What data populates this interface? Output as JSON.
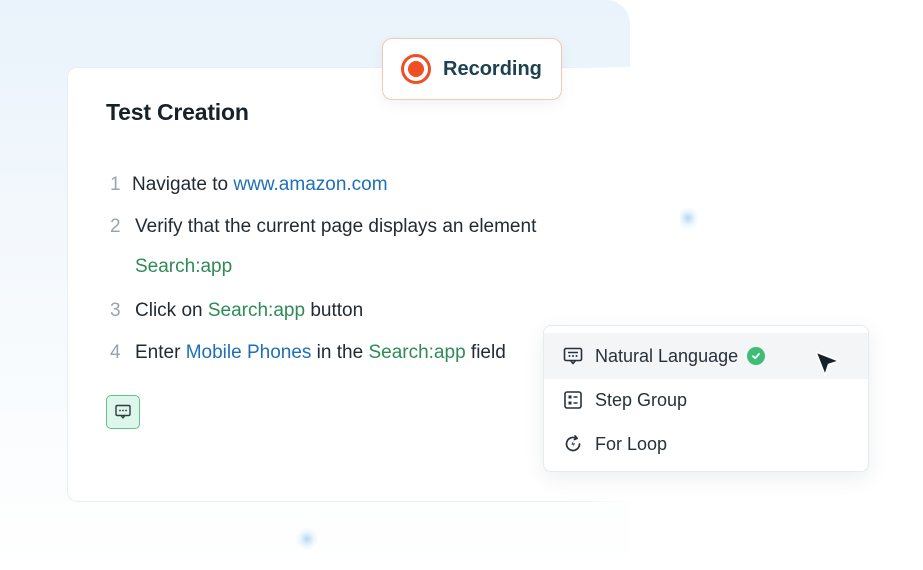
{
  "recording": {
    "label": "Recording",
    "accent": "#f04e23"
  },
  "card": {
    "title": "Test Creation",
    "steps": [
      {
        "number": "1",
        "segments": [
          {
            "text": "Navigate to ",
            "style": "plain"
          },
          {
            "text": "www.amazon.com",
            "style": "blue"
          }
        ]
      },
      {
        "number": "2",
        "segments": [
          {
            "text": "Verify that the current page displays an element",
            "style": "plain"
          }
        ],
        "continuation": "Search:app"
      },
      {
        "number": "3",
        "segments": [
          {
            "text": "Click on ",
            "style": "plain"
          },
          {
            "text": "Search:app",
            "style": "green"
          },
          {
            "text": " button",
            "style": "plain"
          }
        ]
      },
      {
        "number": "4",
        "segments": [
          {
            "text": "Enter ",
            "style": "plain"
          },
          {
            "text": "Mobile Phones",
            "style": "blue"
          },
          {
            "text": " in the ",
            "style": "plain"
          },
          {
            "text": "Search:app",
            "style": "green"
          },
          {
            "text": " field",
            "style": "plain"
          }
        ]
      }
    ],
    "add_step_icon": "message-add-icon"
  },
  "menu": {
    "items": [
      {
        "label": "Natural Language",
        "icon": "message-add-icon",
        "active": true,
        "verified": true
      },
      {
        "label": "Step Group",
        "icon": "list-group-icon",
        "active": false,
        "verified": false
      },
      {
        "label": "For Loop",
        "icon": "loop-icon",
        "active": false,
        "verified": false
      }
    ]
  },
  "colors": {
    "link_blue": "#1f6fb8",
    "link_green": "#2e8b57",
    "check_green": "#3ebd78",
    "title_dark": "#17212b"
  }
}
